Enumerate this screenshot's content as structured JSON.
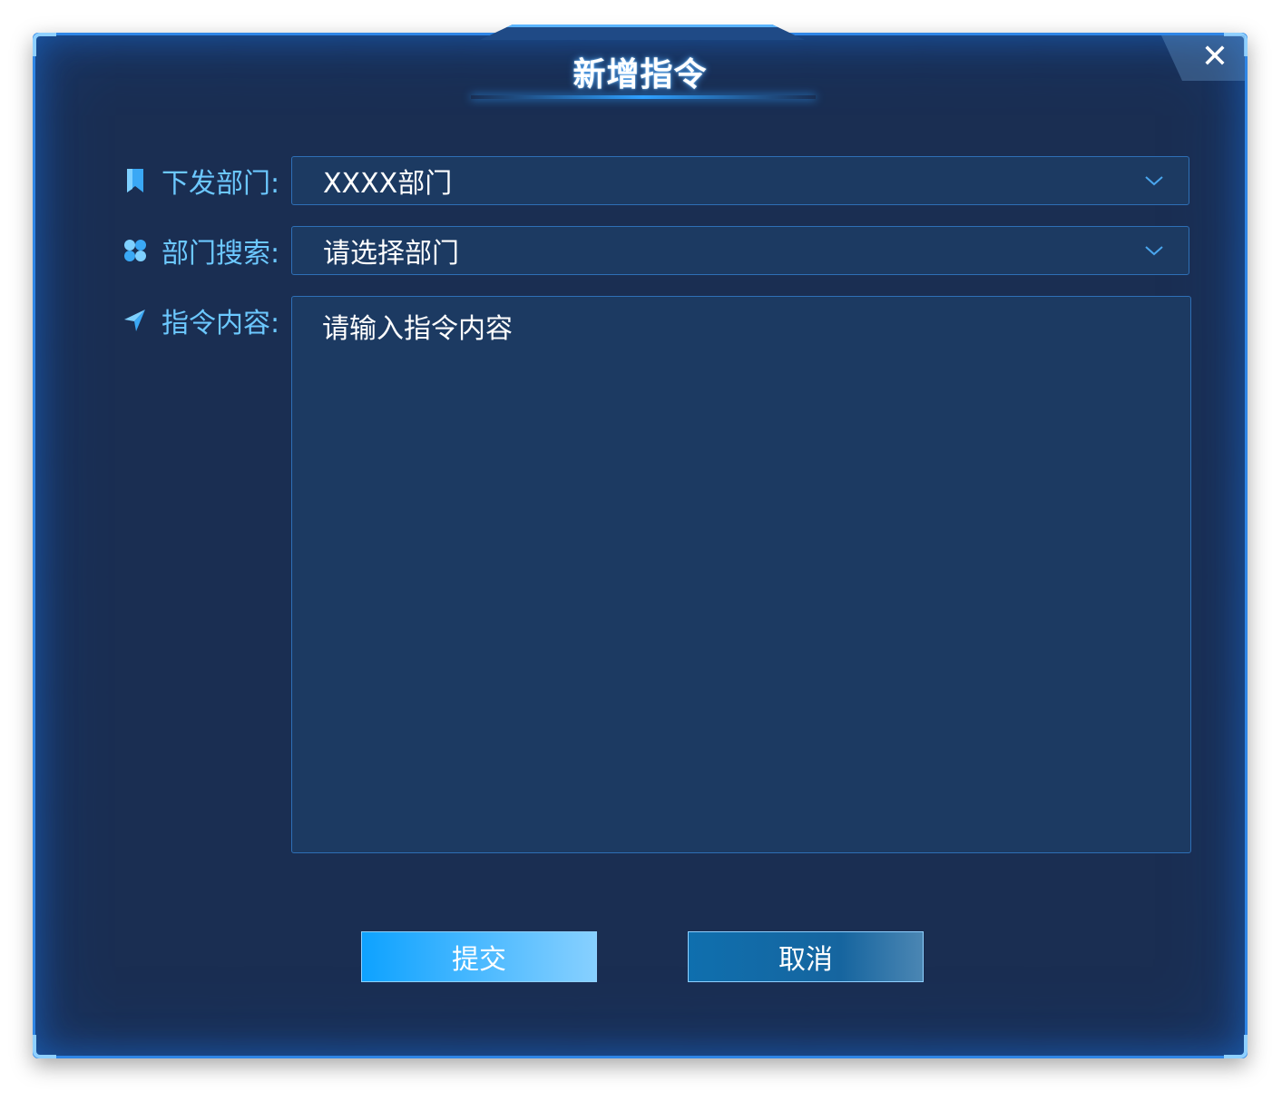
{
  "dialog": {
    "title": "新增指令",
    "close_icon": "close-icon"
  },
  "form": {
    "department": {
      "label": "下发部门:",
      "icon": "bookmark-icon",
      "value": "XXXX部门"
    },
    "department_search": {
      "label": "部门搜索:",
      "icon": "clover-icon",
      "placeholder": "请选择部门"
    },
    "instruction_content": {
      "label": "指令内容:",
      "icon": "send-icon",
      "placeholder": "请输入指令内容"
    }
  },
  "actions": {
    "submit_label": "提交",
    "cancel_label": "取消"
  },
  "colors": {
    "accent": "#2fa0ff",
    "label": "#6cc8ff",
    "panel": "#1a2e52",
    "field": "#1c3a62"
  }
}
